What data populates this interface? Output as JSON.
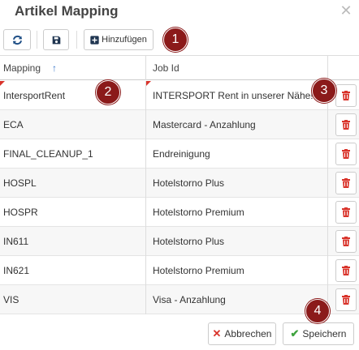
{
  "dialog": {
    "title": "Artikel Mapping",
    "close_glyph": "✕"
  },
  "toolbar": {
    "refresh_icon": "refresh-icon",
    "save_icon": "floppy-disk-icon",
    "add_icon": "plus-square-icon",
    "add_label": "Hinzufügen"
  },
  "badges": [
    "1",
    "2",
    "3",
    "4"
  ],
  "grid": {
    "columns": [
      "Mapping",
      "Job Id",
      ""
    ],
    "sort_indicator": "↑",
    "rows": [
      {
        "mapping": "IntersportRent",
        "job_id": "INTERSPORT Rent in unserer Nähe!"
      },
      {
        "mapping": "ECA",
        "job_id": "Mastercard - Anzahlung"
      },
      {
        "mapping": "FINAL_CLEANUP_1",
        "job_id": "Endreinigung"
      },
      {
        "mapping": "HOSPL",
        "job_id": "Hotelstorno Plus"
      },
      {
        "mapping": "HOSPR",
        "job_id": "Hotelstorno Premium"
      },
      {
        "mapping": "IN611",
        "job_id": "Hotelstorno Plus"
      },
      {
        "mapping": "IN621",
        "job_id": "Hotelstorno Premium"
      },
      {
        "mapping": "VIS",
        "job_id": "Visa - Anzahlung"
      }
    ],
    "delete_icon": "trash-icon"
  },
  "footer": {
    "cancel_label": "Abbrechen",
    "save_label": "Speichern"
  },
  "colors": {
    "badge": "#8b1a1a",
    "danger": "#d9342b",
    "success": "#3fa33f",
    "accent": "#3a78c9"
  }
}
